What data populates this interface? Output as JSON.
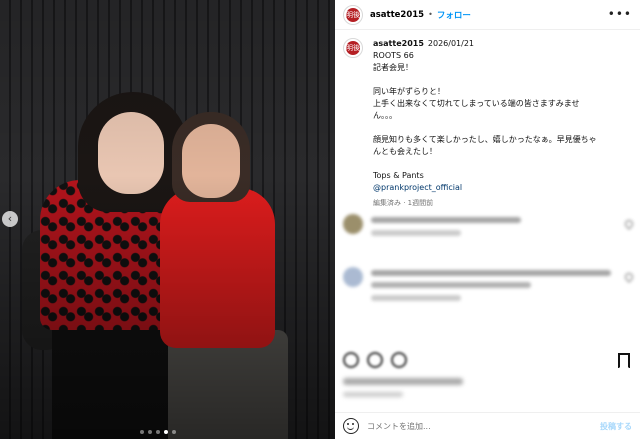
{
  "post": {
    "username": "asatte2015",
    "follow_label": "フォロー",
    "separator": "•",
    "date": "2026/01/21",
    "caption": {
      "line1": "ROOTS 66",
      "line2": "記者会見！",
      "line3": "同い年がずらりと！",
      "line4": "上手く出来なくて切れてしまっている端の皆さますみませ",
      "line5": "ん。。。",
      "line6": "顔見知りも多くて楽しかったし、嬉しかったなぁ。早見優ちゃ",
      "line7": "んとも会えたし！",
      "line8": "Tops & Pants",
      "mention": "@prankproject_official"
    },
    "meta": "編集済み · 1週間前"
  },
  "avatar": {
    "glyph": "明後日"
  },
  "comment_box": {
    "placeholder": "コメントを追加...",
    "post_label": "投稿する"
  },
  "photo": {
    "nav_icon": "chevron-left-icon",
    "nav_glyph": "‹",
    "carousel_count": 5,
    "carousel_active": 4
  },
  "icons": {
    "more": "more-horizontal-icon",
    "bookmark": "bookmark-icon",
    "emoji": "emoji-icon"
  },
  "colors": {
    "follow": "#0095f6",
    "mention": "#00376b",
    "post_disabled": "#a8d8fb",
    "brand_red": "#b51f24"
  }
}
